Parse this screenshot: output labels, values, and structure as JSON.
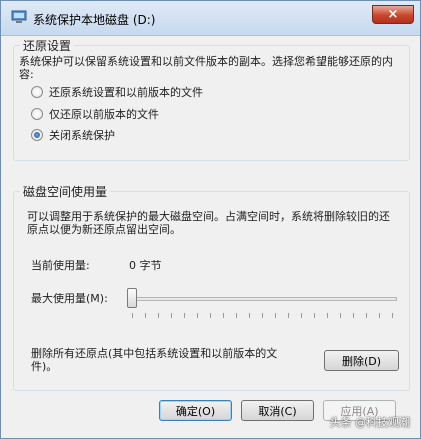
{
  "window": {
    "title": "系统保护本地磁盘 (D:)",
    "close_symbol": "×"
  },
  "restore_settings": {
    "group_label": "还原设置",
    "description": "系统保护可以保留系统设置和以前文件版本的副本。选择您希望能够还原的内容:",
    "options": [
      {
        "label": "还原系统设置和以前版本的文件",
        "checked": false
      },
      {
        "label": "仅还原以前版本的文件",
        "checked": false
      },
      {
        "label": "关闭系统保护",
        "checked": true
      }
    ]
  },
  "disk_usage": {
    "group_label": "磁盘空间使用量",
    "description": "可以调整用于系统保护的最大磁盘空间。占满空间时，系统将删除较旧的还原点以便为新还原点留出空间。",
    "current_label": "当前使用量:",
    "current_value": "0 字节",
    "max_label": "最大使用量(M):",
    "slider_level": 0,
    "delete_description": "删除所有还原点(其中包括系统设置和以前版本的文件)。",
    "delete_button": "删除(D)"
  },
  "footer": {
    "ok": "确定(O)",
    "cancel": "取消(C)",
    "apply": "应用(A)"
  },
  "watermark": "头条 @科技观潮"
}
